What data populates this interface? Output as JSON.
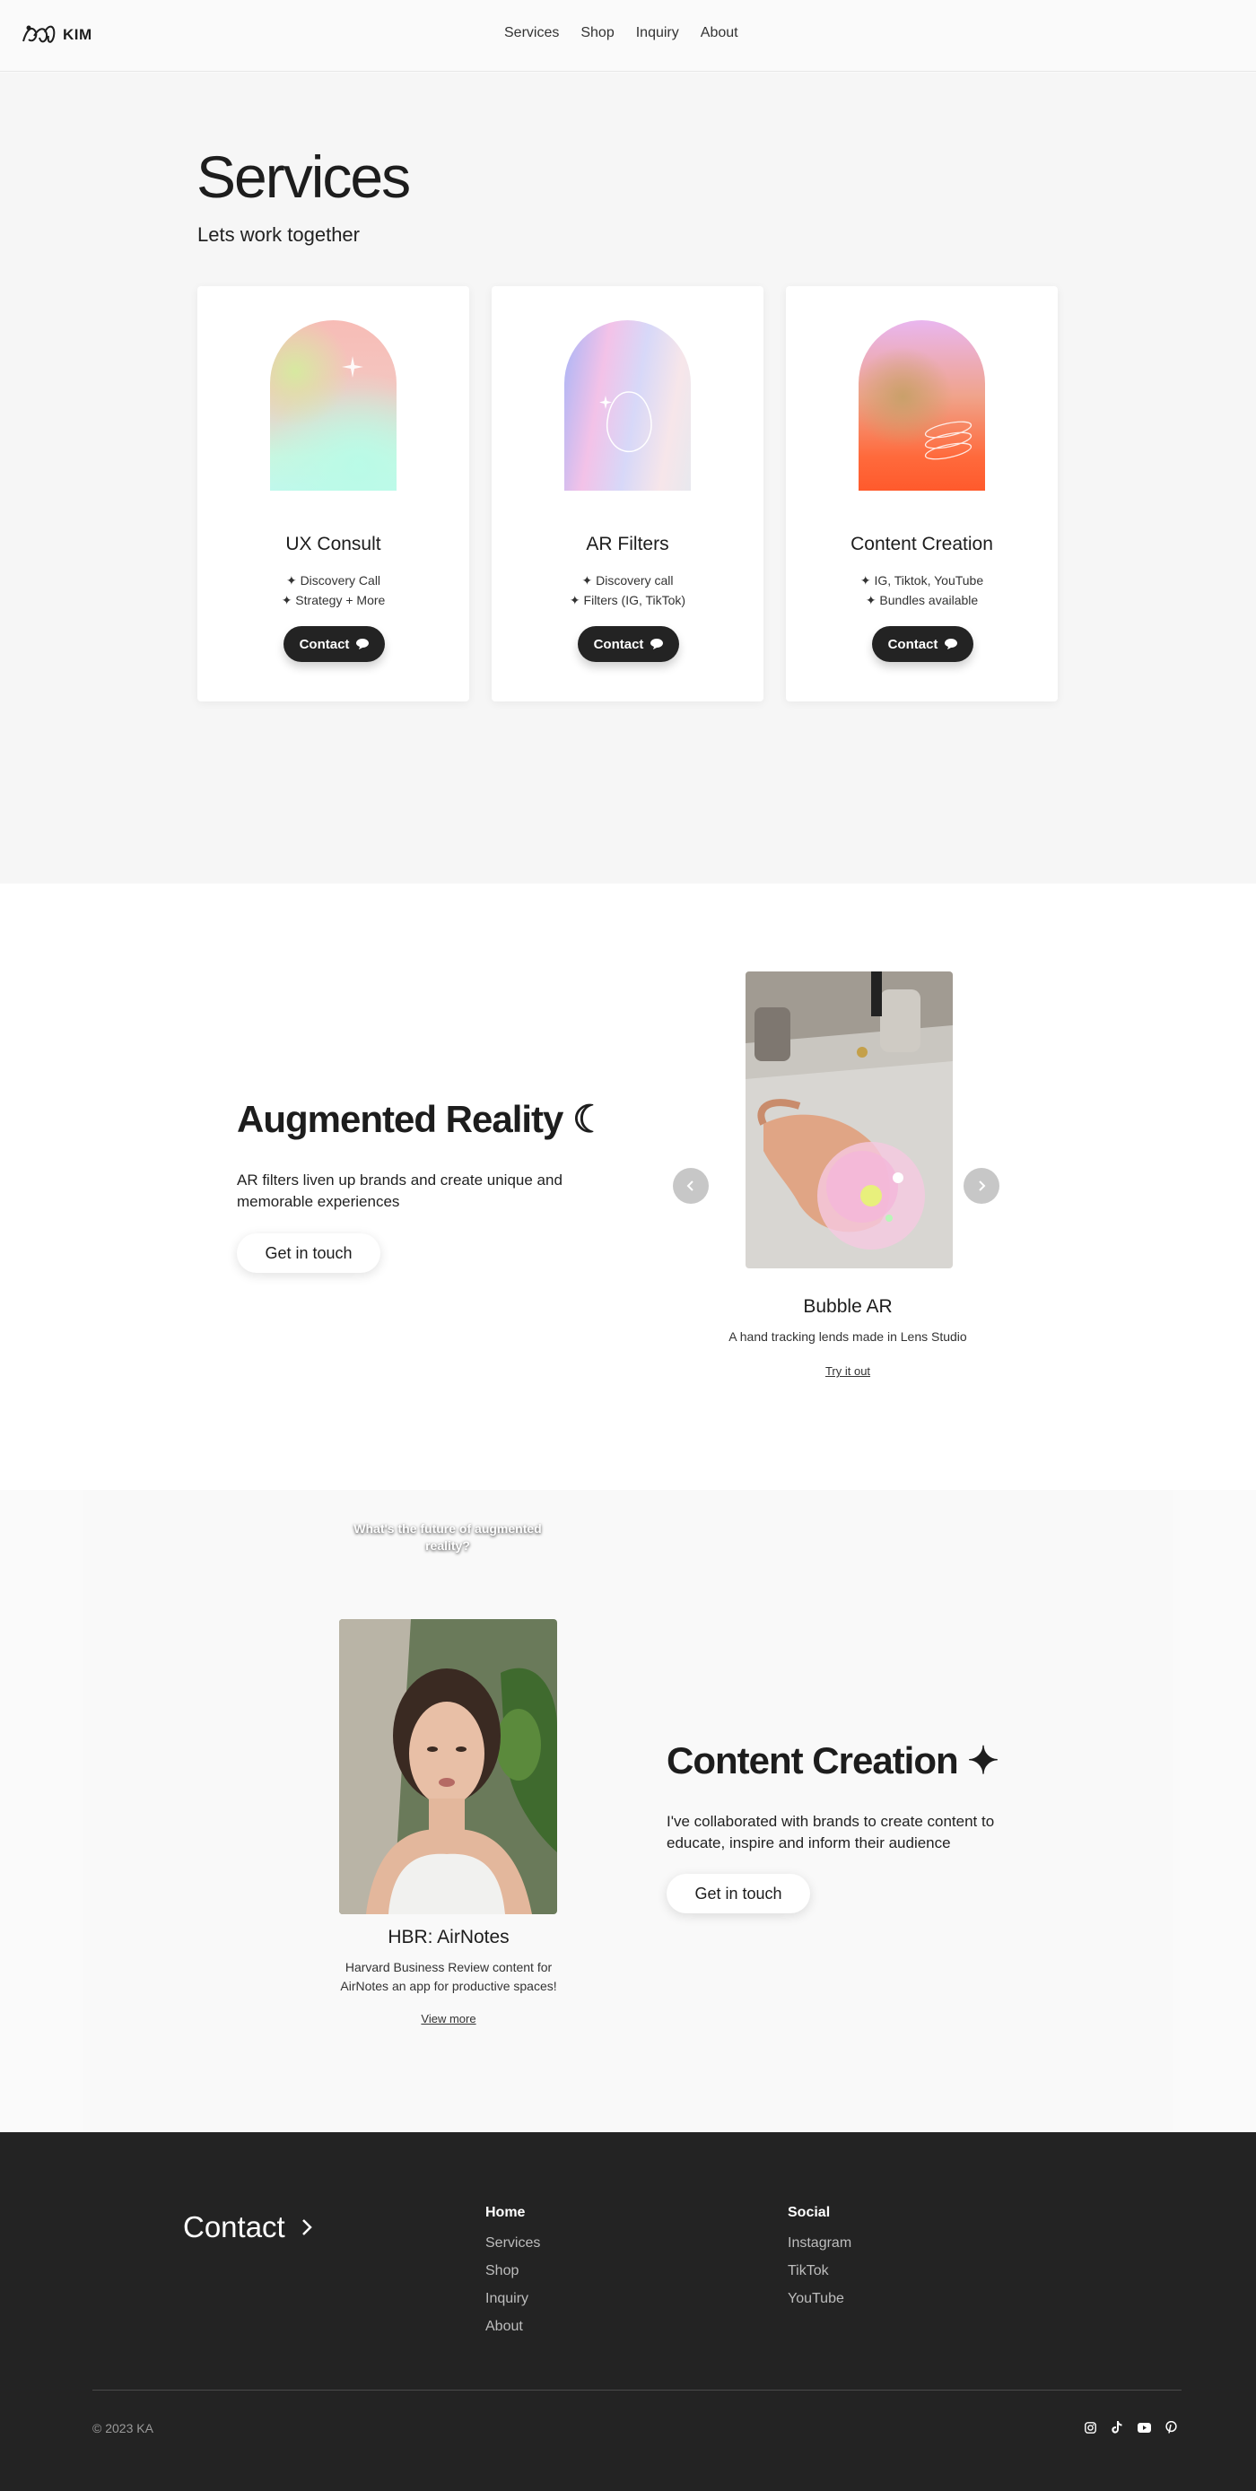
{
  "header": {
    "logo_text": "KIM",
    "nav": [
      "Services",
      "Shop",
      "Inquiry",
      "About"
    ]
  },
  "services": {
    "title": "Services",
    "subtitle": "Lets work together",
    "cards": [
      {
        "title": "UX Consult",
        "features": [
          "✦ Discovery Call",
          "✦ Strategy + More"
        ],
        "button": "Contact"
      },
      {
        "title": "AR Filters",
        "features": [
          "✦ Discovery call",
          "✦ Filters (IG, TikTok)"
        ],
        "button": "Contact"
      },
      {
        "title": "Content Creation",
        "features": [
          "✦ IG, Tiktok, YouTube",
          "✦ Bundles available"
        ],
        "button": "Contact"
      }
    ]
  },
  "ar": {
    "title": "Augmented Reality ☾",
    "text": "AR filters liven up brands and create unique and memorable experiences",
    "button": "Get in touch",
    "item": {
      "title": "Bubble AR",
      "description": "A hand tracking lends made in Lens Studio",
      "link": "Try it out"
    }
  },
  "content_creation": {
    "title": "Content Creation ✦",
    "text": "I've collaborated with brands to create content to educate, inspire and inform their audience",
    "button": "Get in touch",
    "item": {
      "caption": "What's the future of augmented reality?",
      "title": "HBR: AirNotes",
      "description": "Harvard Business Review content for AirNotes an app for productive spaces!",
      "link": "View more"
    }
  },
  "footer": {
    "contact": "Contact",
    "home_heading": "Home",
    "home_links": [
      "Services",
      "Shop",
      "Inquiry",
      "About"
    ],
    "social_heading": "Social",
    "social_links": [
      "Instagram",
      "TikTok",
      "YouTube"
    ],
    "copyright": "© 2023 KA",
    "icons": [
      "instagram-icon",
      "tiktok-icon",
      "youtube-icon",
      "pinterest-icon"
    ]
  },
  "colors": {
    "dark": "#232323",
    "background": "#f6f6f6",
    "footer_text": "#bdbdbd"
  }
}
